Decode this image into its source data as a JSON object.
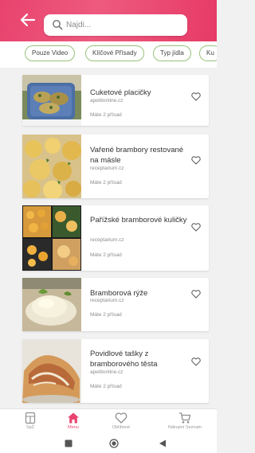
{
  "search": {
    "placeholder": "Najdi..."
  },
  "filters": [
    "Pouze Video",
    "Klíčové Přísady",
    "Typ jídla",
    "Ku"
  ],
  "recipes": [
    {
      "title": "Cuketové placičky",
      "source": "apetitonline.cz",
      "owned": "Máte 2 přísad"
    },
    {
      "title": "Vařené brambory restované na másle",
      "source": "receptarium.cz",
      "owned": "Máte 2 přísad"
    },
    {
      "title": "Pařížské bramborové kuličky",
      "source": "receptarium.cz",
      "owned": "Máte 2 přísad"
    },
    {
      "title": "Bramborová rýže",
      "source": "receptarium.cz",
      "owned": "Máte 2 přísad"
    },
    {
      "title": "Povidlové tašky z bramborového těsta",
      "source": "apetitonline.cz",
      "owned": "Máte 2 přísad"
    }
  ],
  "nav": {
    "items": [
      {
        "label": "SpŽ",
        "icon": "book-icon"
      },
      {
        "label": "Menu",
        "icon": "home-icon"
      },
      {
        "label": "Oblíbené",
        "icon": "heart-icon"
      },
      {
        "label": "Nákupní Seznam",
        "icon": "cart-icon"
      }
    ],
    "active": "Menu"
  },
  "colors": {
    "accent": "#e8436e",
    "chip_border": "#97c27a"
  }
}
